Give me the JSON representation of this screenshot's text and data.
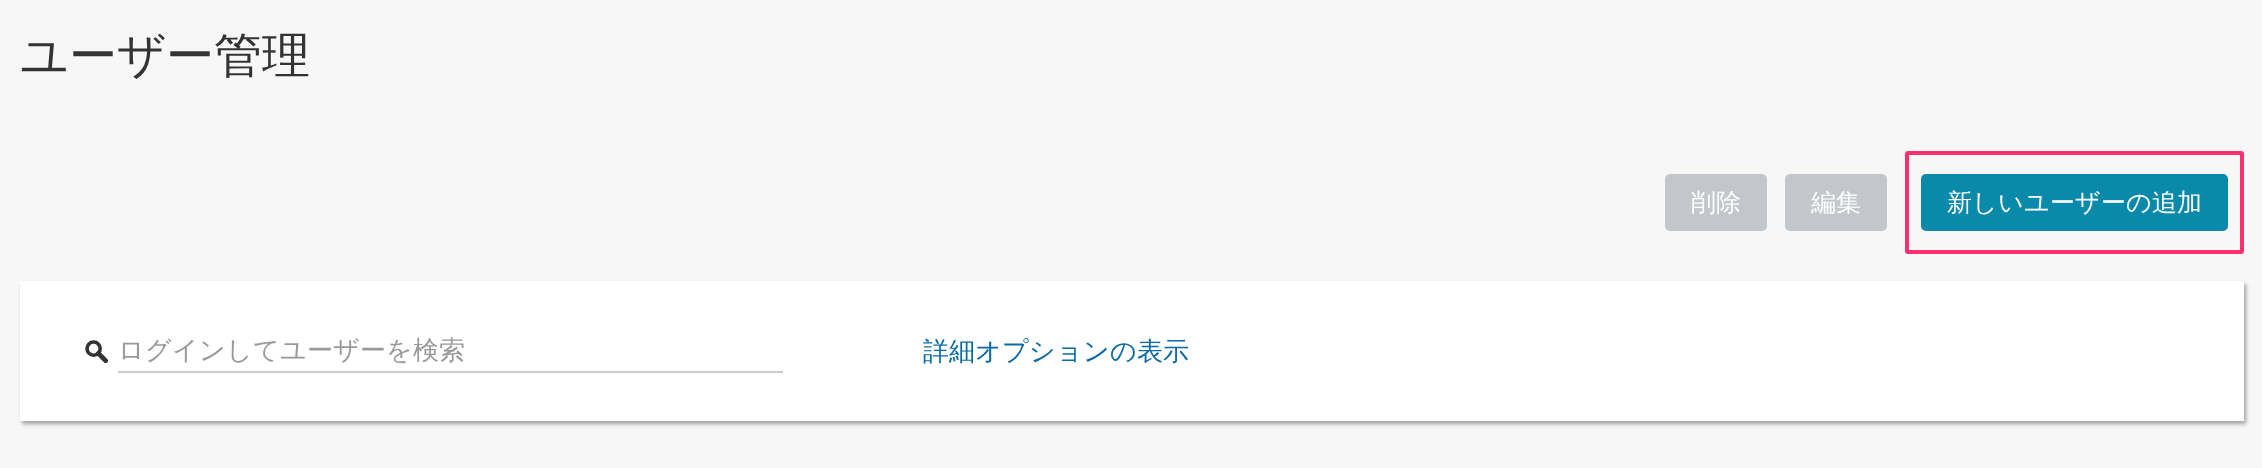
{
  "page": {
    "title": "ユーザー管理"
  },
  "toolbar": {
    "buttons": [
      {
        "label": "削除",
        "disabled": true,
        "highlighted": false
      },
      {
        "label": "編集",
        "disabled": true,
        "highlighted": false
      },
      {
        "label": "新しいユーザーの追加",
        "disabled": false,
        "highlighted": true
      }
    ]
  },
  "search": {
    "placeholder": "ログインしてユーザーを検索",
    "link": "詳細オプションの表示"
  }
}
